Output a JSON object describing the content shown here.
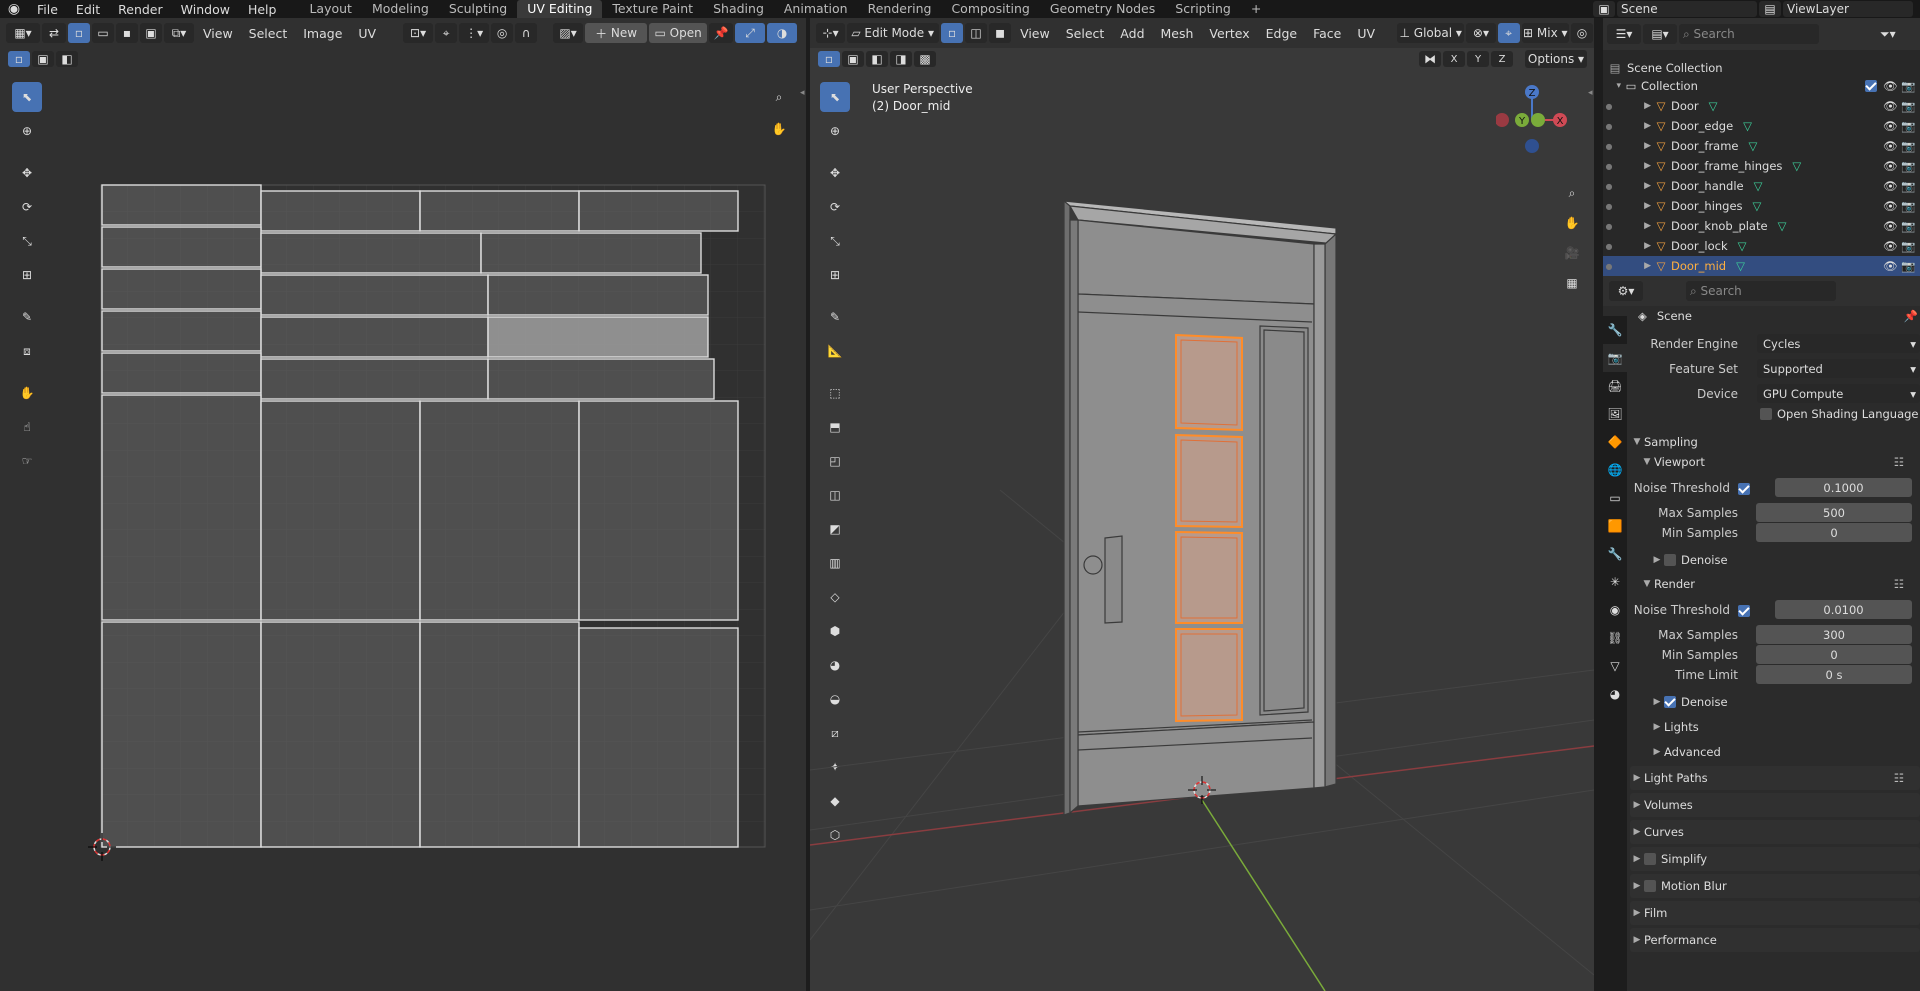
{
  "app": {
    "name": "Blender"
  },
  "topbar": {
    "menus": [
      "File",
      "Edit",
      "Render",
      "Window",
      "Help"
    ],
    "workspaces": [
      "Layout",
      "Modeling",
      "Sculpting",
      "UV Editing",
      "Texture Paint",
      "Shading",
      "Animation",
      "Rendering",
      "Compositing",
      "Geometry Nodes",
      "Scripting"
    ],
    "active_workspace": "UV Editing",
    "add_tab": "+",
    "scene_name": "Scene",
    "view_layer": "ViewLayer"
  },
  "uv_editor": {
    "menus": [
      "View",
      "Select",
      "Image",
      "UV"
    ],
    "new_label": "New",
    "open_label": "Open"
  },
  "viewport": {
    "mode": "Edit Mode",
    "menus": [
      "View",
      "Select",
      "Add",
      "Mesh",
      "Vertex",
      "Edge",
      "Face",
      "UV"
    ],
    "transform_orientation": "Global",
    "shading": "Mix",
    "axes": [
      "X",
      "Y",
      "Z"
    ],
    "options_label": "Options",
    "overlay_line1": "User Perspective",
    "overlay_line2": "(2) Door_mid",
    "gizmo": {
      "z": "Z",
      "y": "Y",
      "x": "X"
    }
  },
  "outliner": {
    "search_placeholder": "Search",
    "scene_collection": "Scene Collection",
    "collection": "Collection",
    "items": [
      {
        "name": "Door",
        "selected": false
      },
      {
        "name": "Door_edge",
        "selected": false
      },
      {
        "name": "Door_frame",
        "selected": false
      },
      {
        "name": "Door_frame_hinges",
        "selected": false
      },
      {
        "name": "Door_handle",
        "selected": false
      },
      {
        "name": "Door_hinges",
        "selected": false
      },
      {
        "name": "Door_knob_plate",
        "selected": false
      },
      {
        "name": "Door_lock",
        "selected": false
      },
      {
        "name": "Door_mid",
        "selected": true
      }
    ]
  },
  "properties": {
    "search_placeholder": "Search",
    "context": "Scene",
    "render_engine_label": "Render Engine",
    "render_engine": "Cycles",
    "feature_set_label": "Feature Set",
    "feature_set": "Supported",
    "device_label": "Device",
    "device": "GPU Compute",
    "osl_label": "Open Shading Language",
    "sampling": "Sampling",
    "viewport": "Viewport",
    "noise_threshold_label": "Noise Threshold",
    "vp_noise_threshold": "0.1000",
    "max_samples_label": "Max Samples",
    "vp_max_samples": "500",
    "min_samples_label": "Min Samples",
    "vp_min_samples": "0",
    "denoise_label": "Denoise",
    "render": "Render",
    "r_noise_threshold": "0.0100",
    "r_max_samples": "300",
    "r_min_samples": "0",
    "time_limit_label": "Time Limit",
    "r_time_limit": "0 s",
    "lights": "Lights",
    "advanced": "Advanced",
    "light_paths": "Light Paths",
    "volumes": "Volumes",
    "curves": "Curves",
    "simplify": "Simplify",
    "motion_blur": "Motion Blur",
    "film": "Film",
    "performance": "Performance"
  },
  "colors": {
    "accent": "#4772b3",
    "selection_orange": "#ff8c28",
    "mesh_grey": "#8e8e8e",
    "x_axis": "#c4404a",
    "y_axis": "#7aab3a"
  }
}
